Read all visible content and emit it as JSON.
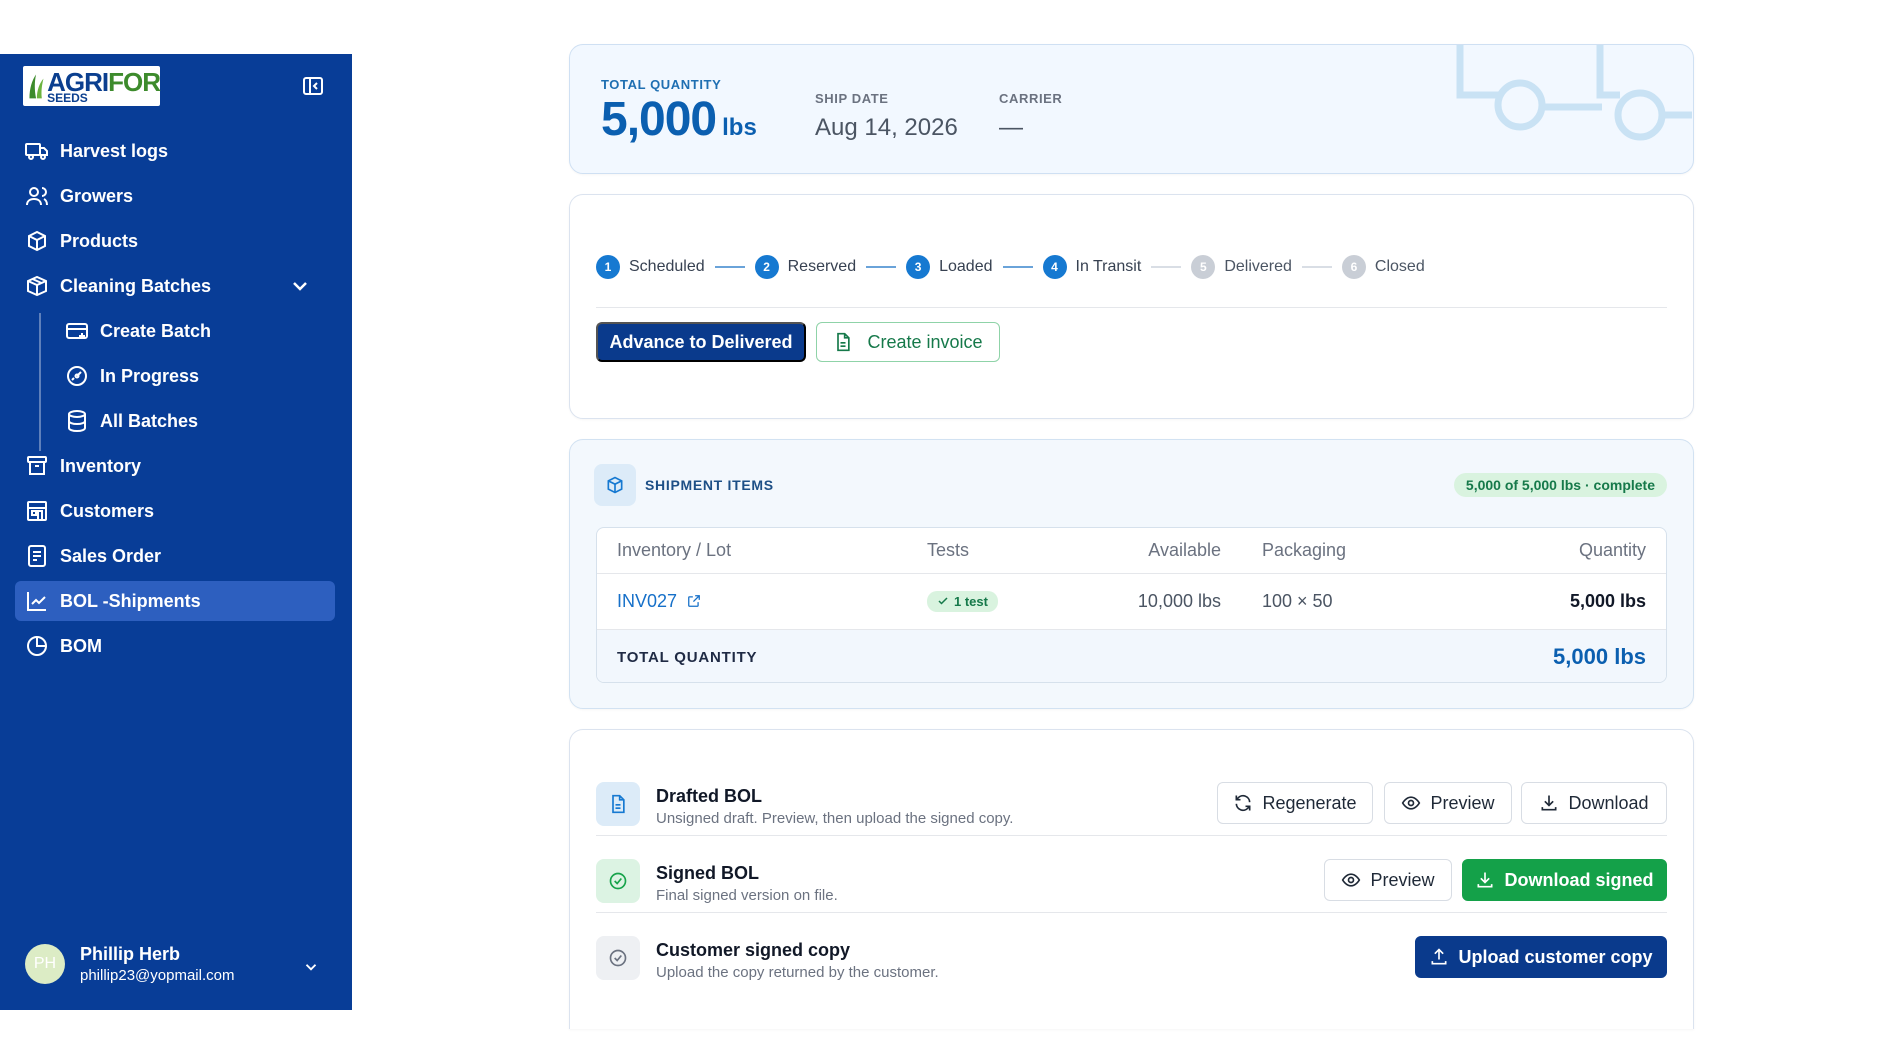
{
  "brand": {
    "name": "AGRIFOR",
    "tagline": "SEEDS"
  },
  "sidebar": {
    "items": [
      {
        "label": "Harvest logs",
        "icon": "truck-icon"
      },
      {
        "label": "Growers",
        "icon": "users-icon"
      },
      {
        "label": "Products",
        "icon": "box-icon"
      },
      {
        "label": "Cleaning Batches",
        "icon": "package-icon",
        "expanded": true
      },
      {
        "label": "Create Batch",
        "icon": "create-batch-icon"
      },
      {
        "label": "In Progress",
        "icon": "progress-icon"
      },
      {
        "label": "All Batches",
        "icon": "database-icon"
      },
      {
        "label": "Inventory",
        "icon": "archive-icon"
      },
      {
        "label": "Customers",
        "icon": "building-icon"
      },
      {
        "label": "Sales Order",
        "icon": "document-icon"
      },
      {
        "label": "BOL -Shipments",
        "icon": "chart-line-icon",
        "active": true
      },
      {
        "label": "BOM",
        "icon": "pie-chart-icon"
      }
    ],
    "user": {
      "initials": "PH",
      "name": "Phillip Herb",
      "email": "phillip23@yopmail.com"
    }
  },
  "summary": {
    "total_quantity_label": "TOTAL QUANTITY",
    "total_quantity_value": "5,000",
    "total_quantity_unit": "lbs",
    "ship_date_label": "SHIP DATE",
    "ship_date_value": "Aug 14, 2026",
    "carrier_label": "CARRIER",
    "carrier_value": "—"
  },
  "status": {
    "steps": [
      {
        "num": "1",
        "label": "Scheduled",
        "state": "done"
      },
      {
        "num": "2",
        "label": "Reserved",
        "state": "done"
      },
      {
        "num": "3",
        "label": "Loaded",
        "state": "done"
      },
      {
        "num": "4",
        "label": "In Transit",
        "state": "current"
      },
      {
        "num": "5",
        "label": "Delivered",
        "state": "pending"
      },
      {
        "num": "6",
        "label": "Closed",
        "state": "pending"
      }
    ],
    "advance_label": "Advance to Delivered",
    "invoice_label": "Create invoice"
  },
  "shipment_items": {
    "title": "SHIPMENT ITEMS",
    "badge": "5,000 of 5,000 lbs · complete",
    "columns": [
      "Inventory / Lot",
      "Tests",
      "Available",
      "Packaging",
      "Quantity"
    ],
    "rows": [
      {
        "lot": "INV027",
        "tests": "1 test",
        "available": "10,000 lbs",
        "packaging": "100 × 50",
        "quantity": "5,000 lbs"
      }
    ],
    "total_label": "TOTAL QUANTITY",
    "total_value": "5,000 lbs"
  },
  "bol": {
    "drafted": {
      "title": "Drafted BOL",
      "subtitle": "Unsigned draft. Preview, then upload the signed copy.",
      "regenerate": "Regenerate",
      "preview": "Preview",
      "download": "Download"
    },
    "signed": {
      "title": "Signed BOL",
      "subtitle": "Final signed version on file.",
      "preview": "Preview",
      "download": "Download signed"
    },
    "customer": {
      "title": "Customer signed copy",
      "subtitle": "Upload the copy returned by the customer.",
      "upload": "Upload customer copy"
    }
  },
  "colors": {
    "sidebar": "#083d97",
    "active": "#2d5fbf",
    "primary": "#0a3a8c",
    "accent": "#1679d1",
    "success": "#14a149"
  }
}
